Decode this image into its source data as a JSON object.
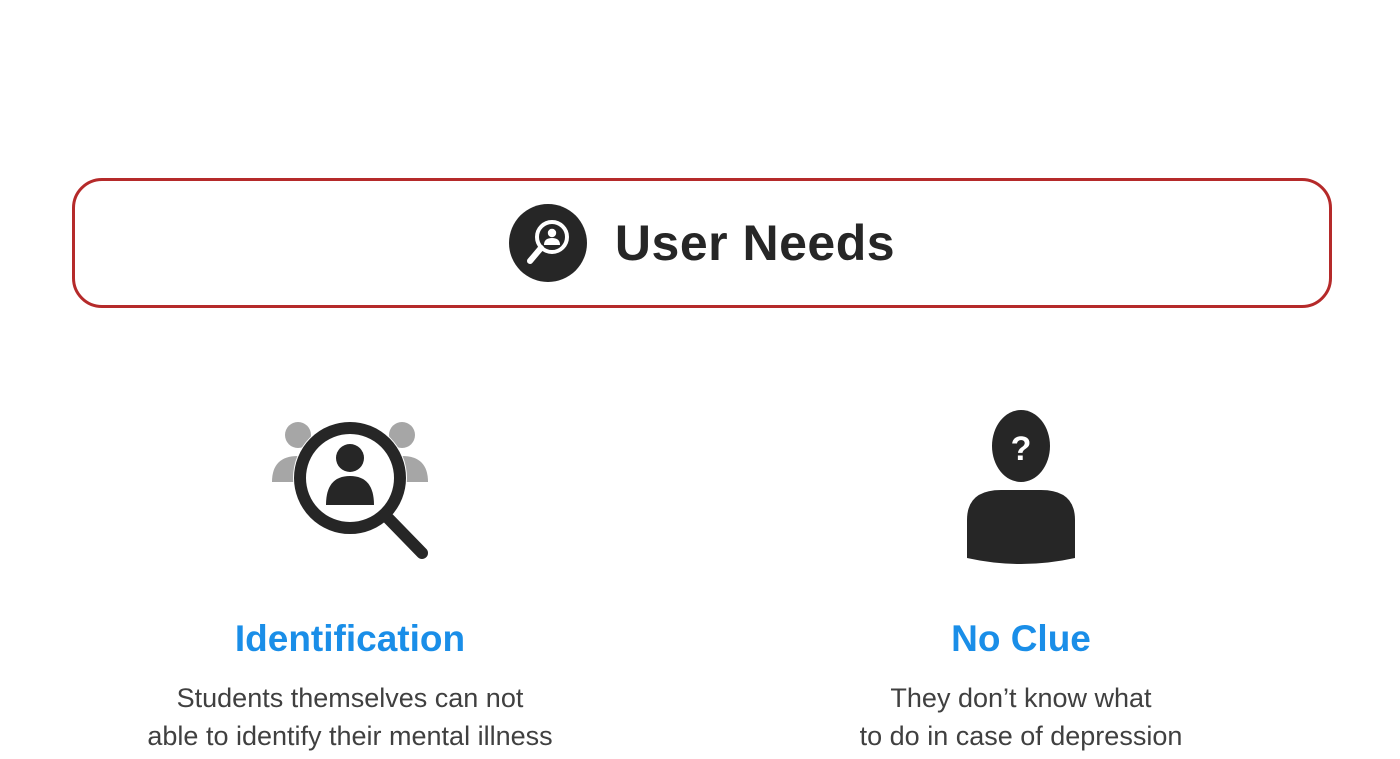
{
  "header": {
    "title": "User Needs",
    "icon": "search-person-icon",
    "border_color": "#b52a2a",
    "text_color": "#262626"
  },
  "items": [
    {
      "icon": "people-magnifier-icon",
      "title": "Identification",
      "description_line1": "Students themselves can not",
      "description_line2": "able to identify their mental illness"
    },
    {
      "icon": "person-question-icon",
      "title": "No Clue",
      "description_line1": "They don’t know what",
      "description_line2": "to do in case of depression"
    }
  ],
  "colors": {
    "accent": "#1a8ee8",
    "icon_dark": "#262626",
    "icon_gray": "#a6a6a6",
    "body_text": "#404040"
  }
}
